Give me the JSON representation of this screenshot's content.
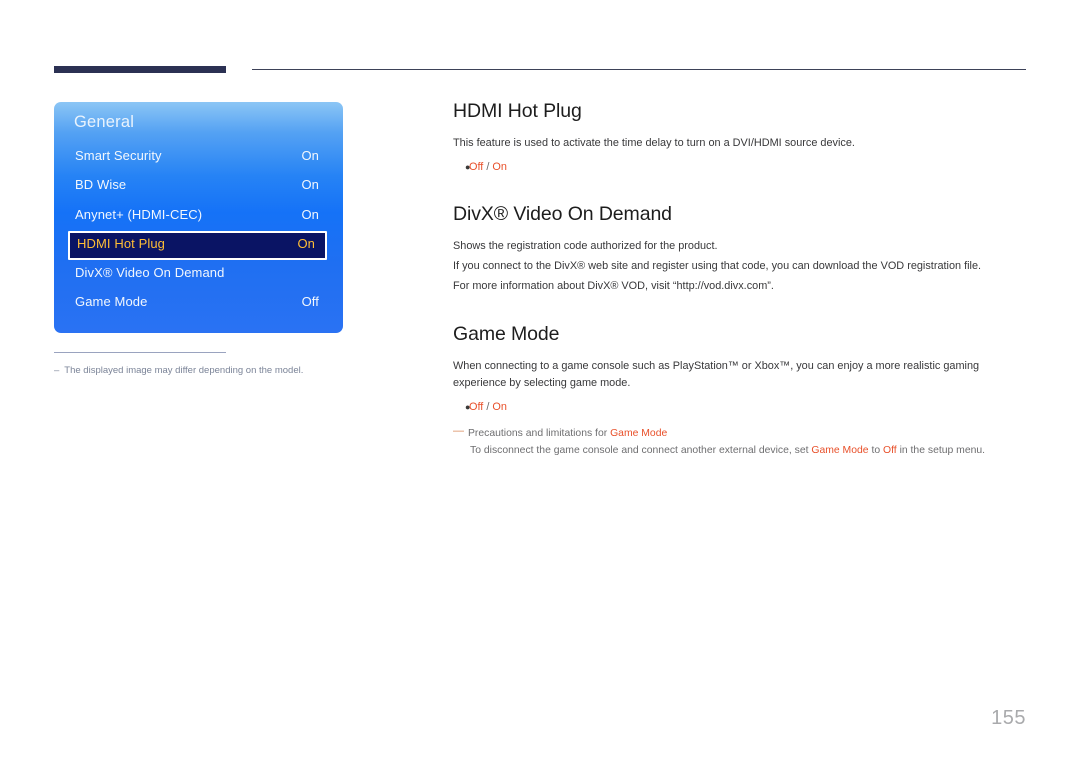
{
  "header": {
    "rule_thick_color": "#2b3153",
    "rule_thin_color": "#3d4258"
  },
  "osd": {
    "title": "General",
    "accent_selected_text": "#ffbe36",
    "selected_background": "#0a1464",
    "panel_blue": "#1572f7",
    "rows": [
      {
        "label": "Smart Security",
        "value": "On",
        "selected": false
      },
      {
        "label": "BD Wise",
        "value": "On",
        "selected": false
      },
      {
        "label": "Anynet+ (HDMI-CEC)",
        "value": "On",
        "selected": false
      },
      {
        "label": "HDMI Hot Plug",
        "value": "On",
        "selected": true
      },
      {
        "label": "DivX® Video On Demand",
        "value": "",
        "selected": false
      },
      {
        "label": "Game Mode",
        "value": "Off",
        "selected": false
      }
    ]
  },
  "left_note": {
    "dash": "–",
    "text": "The displayed image may differ depending on the model."
  },
  "content": {
    "accent_color": "#e8502a",
    "sections": [
      {
        "id": "hdmi-hot-plug",
        "title": "HDMI Hot Plug",
        "paragraphs": [
          "This feature is used to activate the time delay to turn on a DVI/HDMI source device."
        ],
        "bullet": {
          "off": "Off",
          "slash": " / ",
          "on": "On"
        }
      },
      {
        "id": "divx-video-on-demand",
        "title": "DivX® Video On Demand",
        "paragraphs": [
          "Shows the registration code authorized for the product.",
          "If you connect to the DivX® web site and register using that code, you can download the VOD registration file.",
          "For more information about DivX® VOD, visit “http://vod.divx.com”."
        ]
      },
      {
        "id": "game-mode",
        "title": "Game Mode",
        "paragraphs": [
          "When connecting to a game console such as PlayStation™ or Xbox™, you can enjoy a more realistic gaming experience by selecting game mode."
        ],
        "bullet": {
          "off": "Off",
          "slash": " / ",
          "on": "On"
        },
        "note": {
          "dash": "—",
          "line1_prefix": "Precautions and limitations for ",
          "line1_accent": "Game Mode",
          "line2_a": "To disconnect the game console and connect another external device, set ",
          "line2_accent1": "Game Mode",
          "line2_b": " to ",
          "line2_accent2": "Off",
          "line2_c": " in the setup menu."
        }
      }
    ]
  },
  "page_number": "155"
}
